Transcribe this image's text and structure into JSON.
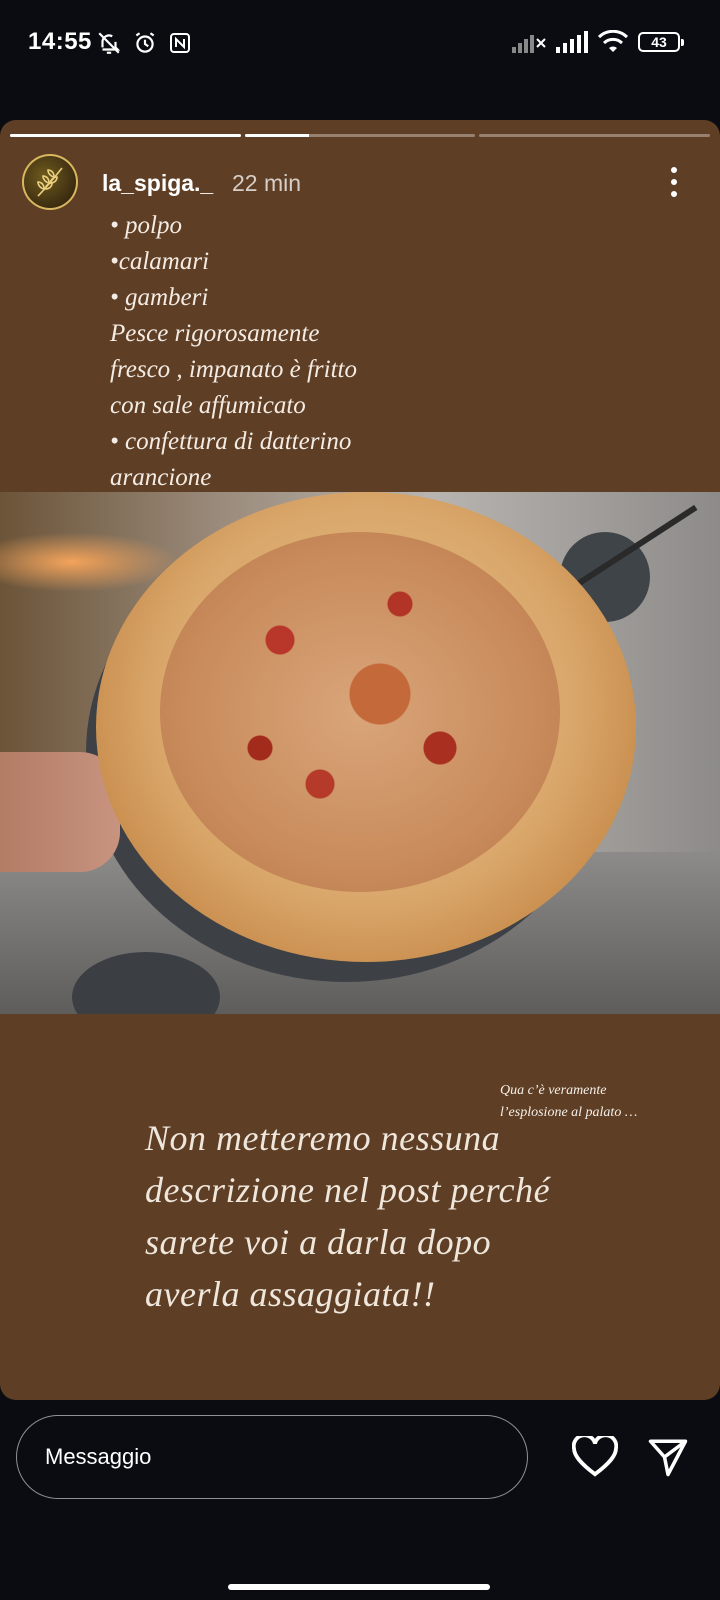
{
  "status_bar": {
    "time": "14:55",
    "battery": "43",
    "icons_left": [
      "bell-off-icon",
      "alarm-icon",
      "nfc-icon"
    ],
    "icons_right": [
      "signal-icon",
      "signal-icon",
      "wifi-icon",
      "battery-icon"
    ]
  },
  "story": {
    "progress": [
      1.0,
      0.28,
      0.0
    ],
    "username": "la_spiga._",
    "time_ago": "22 min",
    "menu_lines": [
      "• polpo",
      "•calamari",
      "• gamberi",
      "Pesce rigorosamente",
      "fresco , impanato è fritto",
      "con sale affumicato",
      "• confettura di datterino",
      "arancione"
    ],
    "photo_caption_lines": [
      "Qua c’è veramente",
      "l’esplosione al palato …"
    ],
    "big_text_lines": [
      "Non metteremo nessuna",
      "descrizione nel post perché",
      "sarete voi a darla dopo",
      "averla assaggiata!!"
    ]
  },
  "reply": {
    "placeholder": "Messaggio"
  },
  "colors": {
    "story_background": "#5e3e24",
    "text_light": "#efe6dc"
  }
}
